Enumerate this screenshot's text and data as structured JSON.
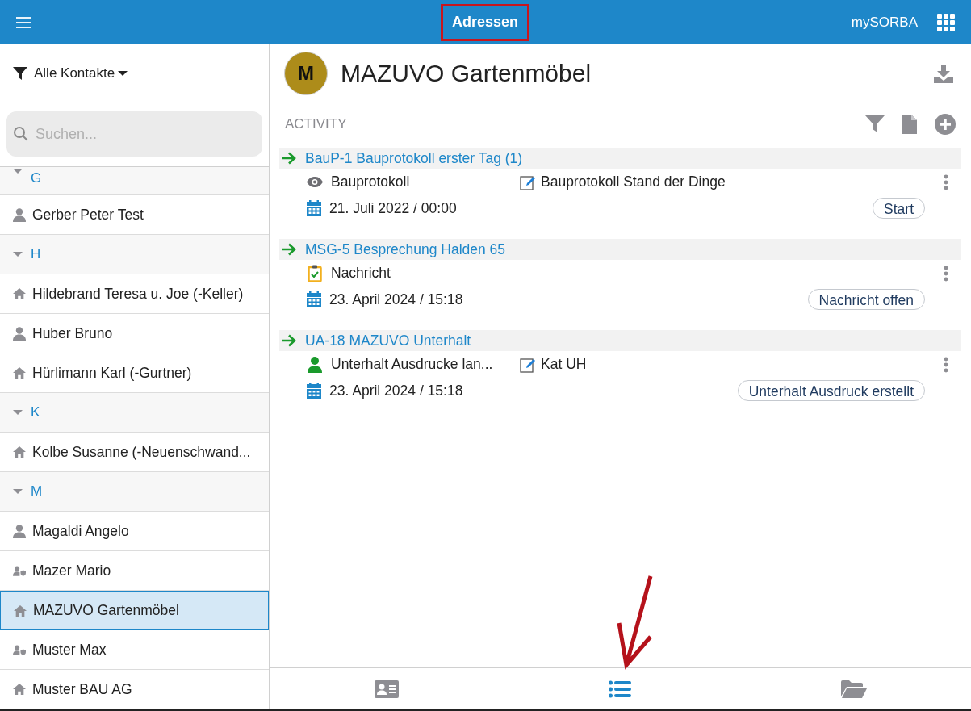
{
  "header": {
    "title": "Adressen",
    "app_name": "mySORBA"
  },
  "sidebar": {
    "filter": "Alle Kontakte",
    "search": {
      "placeholder": "Suchen..."
    },
    "items": [
      {
        "kind": "group",
        "label": "G",
        "expanded": true
      },
      {
        "kind": "person",
        "label": "Gerber Peter Test",
        "selected": false
      },
      {
        "kind": "group",
        "label": "H",
        "expanded": true
      },
      {
        "kind": "company",
        "label": "Hildebrand Teresa u. Joe (-Keller)",
        "selected": false
      },
      {
        "kind": "person",
        "label": "Huber Bruno",
        "selected": false
      },
      {
        "kind": "company",
        "label": "Hürlimann Karl (-Gurtner)",
        "selected": false
      },
      {
        "kind": "group",
        "label": "K",
        "expanded": true
      },
      {
        "kind": "company",
        "label": "Kolbe Susanne (-Neuenschwand...",
        "selected": false
      },
      {
        "kind": "group",
        "label": "M",
        "expanded": true
      },
      {
        "kind": "person",
        "label": "Magaldi Angelo",
        "selected": false
      },
      {
        "kind": "user",
        "label": "Mazer Mario",
        "selected": false
      },
      {
        "kind": "company",
        "label": "MAZUVO Gartenmöbel",
        "selected": true
      },
      {
        "kind": "user",
        "label": "Muster Max",
        "selected": false
      },
      {
        "kind": "company",
        "label": "Muster BAU AG",
        "selected": false
      }
    ]
  },
  "detail": {
    "avatar": "M",
    "name": "MAZUVO Gartenmöbel",
    "section": "ACTIVITY",
    "activities": [
      {
        "title": "BauP-1 Bauprotokoll erster Tag (1)",
        "type": {
          "kind": "view",
          "label": "Bauprotokoll"
        },
        "note": "Bauprotokoll Stand der Dinge",
        "date": "21. Juli 2022 / 00:00",
        "status": "Start"
      },
      {
        "title": "MSG-5 Besprechung Halden 65",
        "type": {
          "kind": "task",
          "label": "Nachricht"
        },
        "date": "23. April 2024 / 15:18",
        "status": "Nachricht offen"
      },
      {
        "title": "UA-18 MAZUVO Unterhalt",
        "type": {
          "kind": "person",
          "label": "Unterhalt Ausdrucke lan..."
        },
        "note": "Kat UH",
        "date": "23. April 2024 / 15:18",
        "status": "Unterhalt Ausdruck erstellt"
      }
    ]
  },
  "bottom_tabs": [
    {
      "kind": "card",
      "selected": false
    },
    {
      "kind": "list",
      "selected": true
    },
    {
      "kind": "folder",
      "selected": false
    }
  ]
}
